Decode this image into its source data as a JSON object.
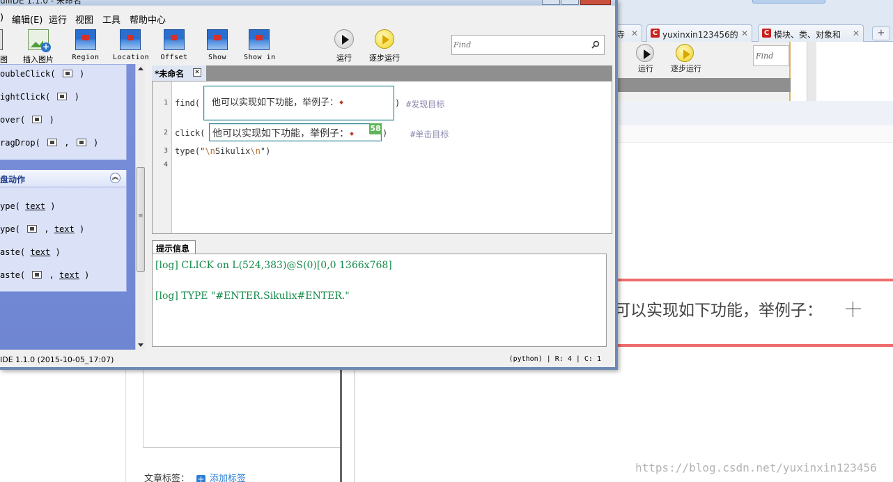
{
  "window": {
    "title": "uliIDE 1.1.0 - 未命名"
  },
  "menu": [
    "编辑(E)",
    "运行",
    "视图",
    "工具",
    "帮助中心"
  ],
  "menu_partial": ")",
  "toolbar": {
    "items": [
      {
        "label": "截图",
        "icon": "camera-icon"
      },
      {
        "label": "插入图片",
        "icon": "insert-image-icon"
      },
      {
        "label": "Region",
        "icon": "region-icon"
      },
      {
        "label": "Location",
        "icon": "location-icon"
      },
      {
        "label": "Offset",
        "icon": "offset-icon"
      },
      {
        "label": "Show",
        "icon": "show-icon"
      },
      {
        "label": "Show in",
        "icon": "show-in-icon"
      }
    ],
    "run_label": "运行",
    "step_label": "逐步运行",
    "find_placeholder": "Find"
  },
  "left_panel": {
    "mouse_actions": [
      "oubleClick(",
      "ightClick(",
      "over(",
      "ragDrop("
    ],
    "section_header": "盘动作",
    "keyboard_actions": [
      {
        "fn": "ype(",
        "arg": "text"
      },
      {
        "fn": "ype(",
        "arg": "text"
      },
      {
        "fn": "aste(",
        "arg": "text"
      },
      {
        "fn": "aste(",
        "arg": "text"
      }
    ]
  },
  "editor": {
    "tab_title": "*未命名",
    "line_numbers": [
      "1",
      "2",
      "3",
      "4"
    ],
    "line1_fn": "find(",
    "line1_close": ")",
    "line1_comment": "#发现目标",
    "line2_fn": "click(",
    "line2_close": ")",
    "line2_comment": "#单击目标",
    "line3_fn": "type(",
    "line3_q1": "\"",
    "line3_esc1": "\\n",
    "line3_word": "Sikulix",
    "line3_esc2": "\\n",
    "line3_q2": "\")",
    "pattern_text": "他可以实现如下功能，举例子：",
    "pattern2_text": "他可以实现如下功能，举例子：",
    "pattern2_similarity": "58"
  },
  "messages": {
    "tab": "提示信息",
    "lines": [
      "[log] CLICK on L(524,383)@S(0)[0,0 1366x768]",
      "[log] TYPE \"#ENTER.Sikulix#ENTER.\""
    ]
  },
  "statusbar": {
    "left": "IDE 1.1.0 (2015-10-05_17:07)",
    "right": "(python) | R: 4 | C: 1"
  },
  "background": {
    "tabs": [
      "寺",
      "yuxinxin123456的",
      "模块、类、对象和"
    ],
    "run_label": "运行",
    "step_label": "逐步运行",
    "find_placeholder": "Find",
    "highlight_text": "可以实现如下功能，举例子：",
    "tags_label": "文章标签：",
    "add_tag": "添加标签",
    "watermark": "https://blog.csdn.net/yuxinxin123456"
  }
}
